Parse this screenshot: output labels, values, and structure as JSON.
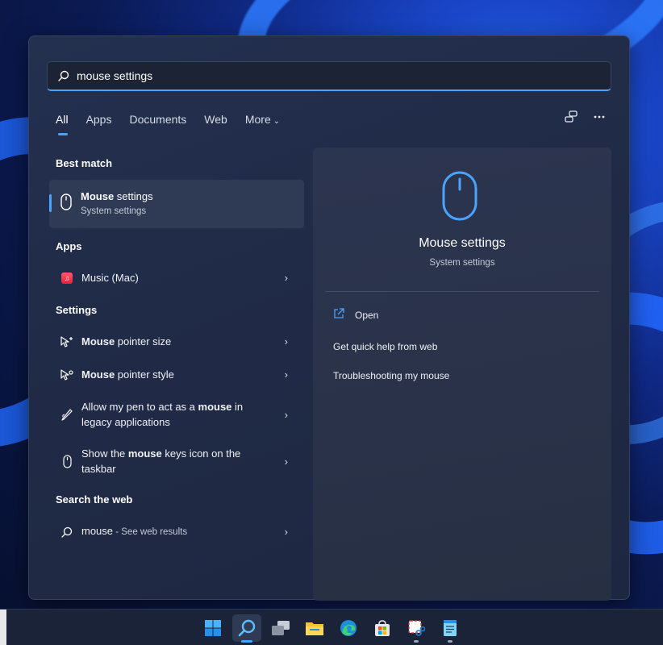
{
  "search": {
    "value": "mouse settings"
  },
  "tabs": [
    {
      "label": "All",
      "active": true
    },
    {
      "label": "Apps"
    },
    {
      "label": "Documents"
    },
    {
      "label": "Web"
    },
    {
      "label": "More",
      "has_dropdown": true
    }
  ],
  "top_icons": [
    "share-accounts-icon",
    "more-options-icon"
  ],
  "sections": {
    "best_match": "Best match",
    "apps": "Apps",
    "settings": "Settings",
    "search_web": "Search the web"
  },
  "best_match": {
    "title_bold": "Mouse",
    "title_rest": " settings",
    "subtitle": "System settings",
    "icon": "mouse-icon"
  },
  "apps": [
    {
      "label": "Music (Mac)",
      "icon": "music-icon"
    }
  ],
  "settings": [
    {
      "pre": "",
      "bold": "Mouse",
      "post": " pointer size",
      "icon": "pointer-size-icon"
    },
    {
      "pre": "",
      "bold": "Mouse",
      "post": " pointer style",
      "icon": "pointer-style-icon"
    },
    {
      "pre": "Allow my pen to act as a ",
      "bold": "mouse",
      "post": " in legacy applications",
      "icon": "pen-icon"
    },
    {
      "pre": "Show the ",
      "bold": "mouse",
      "post": " keys icon on the taskbar",
      "icon": "mouse-icon"
    }
  ],
  "web": {
    "query": "mouse",
    "suffix": " - See web results",
    "icon": "search-icon"
  },
  "preview": {
    "title": "Mouse settings",
    "subtitle": "System settings",
    "actions": [
      "Open",
      "Get quick help from web",
      "Troubleshooting my mouse"
    ]
  },
  "taskbar": [
    "start-icon",
    "search-icon",
    "task-view-icon",
    "file-explorer-icon",
    "edge-icon",
    "store-icon",
    "snipping-tool-icon",
    "notepad-icon"
  ],
  "colors": {
    "accent": "#4aa3ff",
    "panel": "#222c48",
    "taskbar": "#1b2338"
  }
}
